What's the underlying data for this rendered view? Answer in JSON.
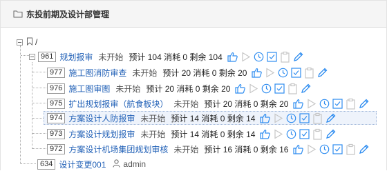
{
  "panel": {
    "title": "东投前期及设计部管理",
    "folder_icon": "folder-icon"
  },
  "root": {
    "label": "/"
  },
  "parent": {
    "code": "961",
    "name": "规划报审",
    "status": "未开始",
    "stats": "预计 104 消耗 0 剩余 104"
  },
  "children": [
    {
      "code": "977",
      "name": "施工图消防审查",
      "status": "未开始",
      "stats": "预计 20 消耗 0 剩余 20"
    },
    {
      "code": "976",
      "name": "施工图审图",
      "status": "未开始",
      "stats": "预计 20 消耗 0 剩余 20"
    },
    {
      "code": "975",
      "name": "扩出规划报审（航食板块）",
      "status": "未开始",
      "stats": "预计 20 消耗 0 剩余 20"
    },
    {
      "code": "974",
      "name": "方案设计人防报审",
      "status": "未开始",
      "stats": "预计 14 消耗 0 剩余 14"
    },
    {
      "code": "973",
      "name": "方案设计规划报审",
      "status": "未开始",
      "stats": "预计 14 消耗 0 剩余 14"
    },
    {
      "code": "972",
      "name": "方案设计机场集团规划审核",
      "status": "未开始",
      "stats": "预计 16 消耗 0 剩余 16"
    }
  ],
  "sibling": {
    "code": "634",
    "name": "设计变更001",
    "owner": "admin"
  },
  "colors": {
    "accent": "#2d8cf0",
    "link": "#1f5fb6",
    "selected_bg": "#eef3fb"
  }
}
